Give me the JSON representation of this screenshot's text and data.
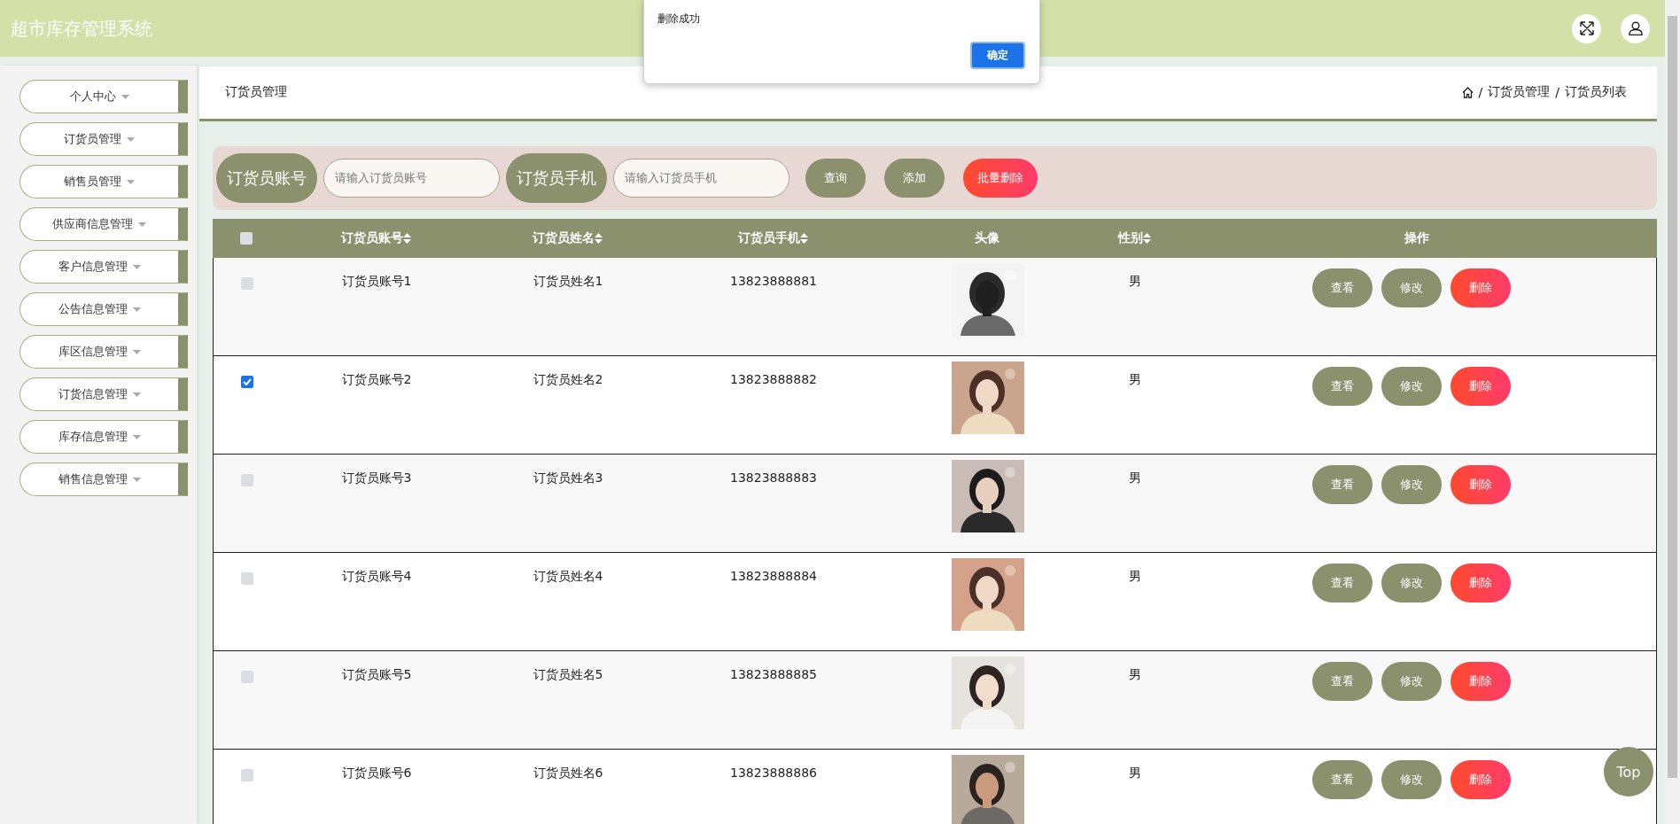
{
  "header": {
    "title": "超市库存管理系统"
  },
  "sidebar": {
    "items": [
      {
        "label": "个人中心"
      },
      {
        "label": "订货员管理"
      },
      {
        "label": "销售员管理"
      },
      {
        "label": "供应商信息管理"
      },
      {
        "label": "客户信息管理"
      },
      {
        "label": "公告信息管理"
      },
      {
        "label": "库区信息管理"
      },
      {
        "label": "订货信息管理"
      },
      {
        "label": "库存信息管理"
      },
      {
        "label": "销售信息管理"
      }
    ]
  },
  "breadcrumb": {
    "page_title": "订货员管理",
    "separator": "/",
    "path": [
      "订货员管理",
      "订货员列表"
    ]
  },
  "search": {
    "fields": [
      {
        "label": "订货员账号",
        "placeholder": "请输入订货员账号"
      },
      {
        "label": "订货员手机",
        "placeholder": "请输入订货员手机"
      }
    ],
    "buttons": [
      {
        "label": "查询",
        "kind": "primary"
      },
      {
        "label": "添加",
        "kind": "primary"
      },
      {
        "label": "批量删除",
        "kind": "danger"
      }
    ]
  },
  "table": {
    "select_all": {
      "checked": false
    },
    "columns": [
      {
        "label": "订货员账号",
        "sortable": true
      },
      {
        "label": "订货员姓名",
        "sortable": true
      },
      {
        "label": "订货员手机",
        "sortable": true
      },
      {
        "label": "头像",
        "sortable": false
      },
      {
        "label": "性别",
        "sortable": true
      },
      {
        "label": "操作",
        "sortable": false
      }
    ],
    "rows": [
      {
        "selected": false,
        "account": "订货员账号1",
        "name": "订货员姓名1",
        "phone": "13823888881",
        "sex": "男",
        "actions": [
          {
            "label": "查看",
            "kind": "primary"
          },
          {
            "label": "修改",
            "kind": "primary"
          },
          {
            "label": "删除",
            "kind": "danger"
          }
        ]
      },
      {
        "selected": true,
        "account": "订货员账号2",
        "name": "订货员姓名2",
        "phone": "13823888882",
        "sex": "男",
        "actions": [
          {
            "label": "查看",
            "kind": "primary"
          },
          {
            "label": "修改",
            "kind": "primary"
          },
          {
            "label": "删除",
            "kind": "danger"
          }
        ]
      },
      {
        "selected": false,
        "account": "订货员账号3",
        "name": "订货员姓名3",
        "phone": "13823888883",
        "sex": "男",
        "actions": [
          {
            "label": "查看",
            "kind": "primary"
          },
          {
            "label": "修改",
            "kind": "primary"
          },
          {
            "label": "删除",
            "kind": "danger"
          }
        ]
      },
      {
        "selected": false,
        "account": "订货员账号4",
        "name": "订货员姓名4",
        "phone": "13823888884",
        "sex": "男",
        "actions": [
          {
            "label": "查看",
            "kind": "primary"
          },
          {
            "label": "修改",
            "kind": "primary"
          },
          {
            "label": "删除",
            "kind": "danger"
          }
        ]
      },
      {
        "selected": false,
        "account": "订货员账号5",
        "name": "订货员姓名5",
        "phone": "13823888885",
        "sex": "男",
        "actions": [
          {
            "label": "查看",
            "kind": "primary"
          },
          {
            "label": "修改",
            "kind": "primary"
          },
          {
            "label": "删除",
            "kind": "danger"
          }
        ]
      },
      {
        "selected": false,
        "account": "订货员账号6",
        "name": "订货员姓名6",
        "phone": "13823888886",
        "sex": "男",
        "actions": [
          {
            "label": "查看",
            "kind": "primary"
          },
          {
            "label": "修改",
            "kind": "primary"
          },
          {
            "label": "删除",
            "kind": "danger"
          }
        ]
      }
    ]
  },
  "dialog": {
    "message": "删除成功",
    "button": "确定"
  },
  "back_to_top": {
    "label": "Top"
  }
}
